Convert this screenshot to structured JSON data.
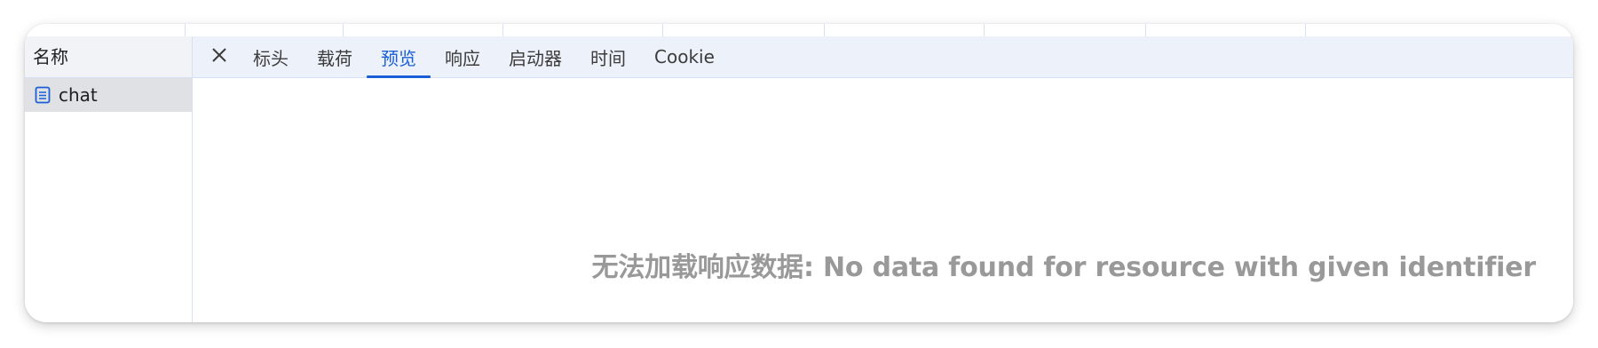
{
  "sidebar": {
    "header": "名称",
    "requests": [
      {
        "label": "chat",
        "icon": "document-icon"
      }
    ]
  },
  "tabs": [
    {
      "label": "标头",
      "active": false
    },
    {
      "label": "载荷",
      "active": false
    },
    {
      "label": "预览",
      "active": true
    },
    {
      "label": "响应",
      "active": false
    },
    {
      "label": "启动器",
      "active": false
    },
    {
      "label": "时间",
      "active": false
    },
    {
      "label": "Cookie",
      "active": false
    }
  ],
  "close_icon": "close-icon",
  "preview": {
    "message": "无法加载响应数据: No data found for resource with given identifier"
  },
  "colors": {
    "accent": "#1a5fd6",
    "tabbar_bg": "#edf1fa",
    "selected_row_bg": "#dfe1e4",
    "message_text": "#999999"
  }
}
